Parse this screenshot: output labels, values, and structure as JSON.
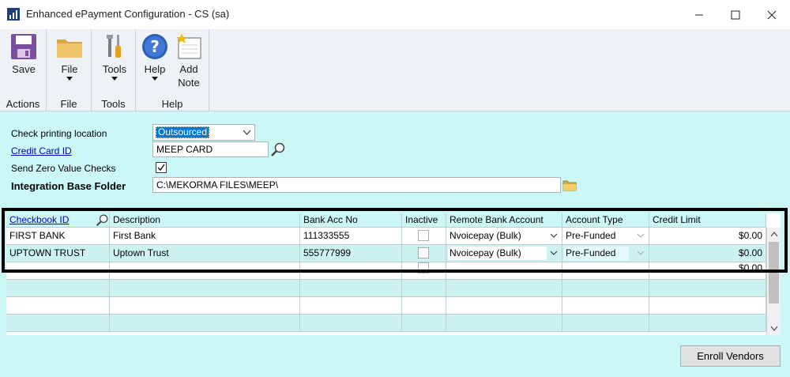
{
  "window": {
    "title": "Enhanced ePayment Configuration  -  CS (sa)"
  },
  "ribbon": {
    "groups": [
      {
        "label": "Actions",
        "buttons": [
          {
            "label": "Save",
            "icon": "save-icon"
          }
        ]
      },
      {
        "label": "File",
        "buttons": [
          {
            "label": "File",
            "icon": "folder-icon",
            "dropdown": true
          }
        ]
      },
      {
        "label": "Tools",
        "buttons": [
          {
            "label": "Tools",
            "icon": "tools-icon",
            "dropdown": true
          }
        ]
      },
      {
        "label": "Help",
        "buttons": [
          {
            "label": "Help",
            "icon": "help-icon",
            "dropdown": true
          },
          {
            "label": "Add",
            "label2": "Note",
            "icon": "add-note-icon"
          }
        ]
      }
    ]
  },
  "form": {
    "check_printing_location": {
      "label": "Check printing location",
      "value": "Outsourced"
    },
    "credit_card_id": {
      "label": "Credit Card ID",
      "value": "MEEP CARD"
    },
    "send_zero_value_checks": {
      "label": "Send Zero Value Checks",
      "checked": true
    },
    "integration_base_folder": {
      "label": "Integration Base Folder",
      "value": "C:\\MEKORMA FILES\\MEEP\\"
    }
  },
  "grid": {
    "columns": [
      "Checkbook ID",
      "Description",
      "Bank Acc No",
      "Inactive",
      "Remote Bank Account",
      "Account Type",
      "Credit Limit"
    ],
    "rows": [
      {
        "checkbook_id": "FIRST BANK",
        "description": "First Bank",
        "bank_acc_no": "111333555",
        "inactive": false,
        "remote_bank_account": "Nvoicepay (Bulk)",
        "account_type": "Pre-Funded",
        "credit_limit": "$0.00"
      },
      {
        "checkbook_id": "UPTOWN TRUST",
        "description": "Uptown Trust",
        "bank_acc_no": "555777999",
        "inactive": false,
        "remote_bank_account": "Nvoicepay (Bulk)",
        "account_type": "Pre-Funded",
        "credit_limit": "$0.00"
      },
      {
        "checkbook_id": "",
        "description": "",
        "bank_acc_no": "",
        "inactive": false,
        "remote_bank_account": "",
        "account_type": "",
        "credit_limit": "$0.00"
      }
    ]
  },
  "footer": {
    "enroll_button": "Enroll Vendors"
  },
  "colors": {
    "background": "#ccf7f7",
    "ribbon": "#eef2f7",
    "link": "#0000cc",
    "selection": "#0078d7"
  }
}
